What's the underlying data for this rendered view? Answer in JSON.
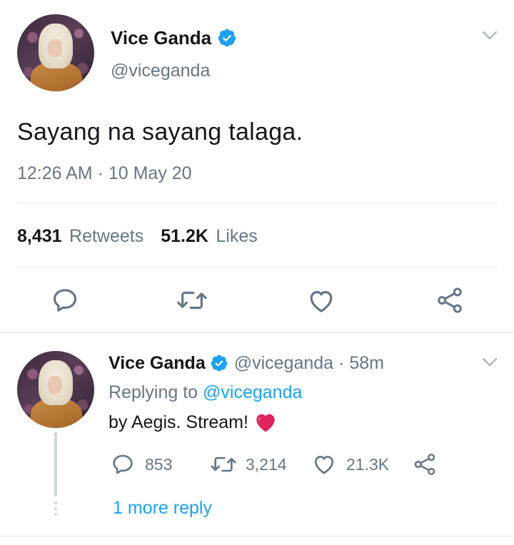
{
  "tweet": {
    "author_name": "Vice Ganda",
    "author_handle": "@viceganda",
    "text": "Sayang na sayang talaga.",
    "timestamp": "12:26 AM · 10 May 20",
    "retweet_count": "8,431",
    "retweet_label": "Retweets",
    "like_count": "51.2K",
    "like_label": "Likes",
    "actions": [
      "reply-icon",
      "retweet-icon",
      "like-icon",
      "share-icon"
    ]
  },
  "reply": {
    "author_name": "Vice Ganda",
    "author_handle": "@viceganda",
    "time": "· 58m",
    "replying_prefix": "Replying to",
    "replying_handle": "@viceganda",
    "text": "by Aegis. Stream!",
    "emoji": "heart-emoji",
    "reply_count": "853",
    "retweet_count": "3,214",
    "like_count": "21.3K",
    "more_reply": "1 more reply"
  },
  "colors": {
    "accent": "#1da1f2",
    "secondary_text": "#657786",
    "primary_text": "#14171a",
    "divider": "#e1e8ed",
    "emoji_red": "#e0245e"
  }
}
